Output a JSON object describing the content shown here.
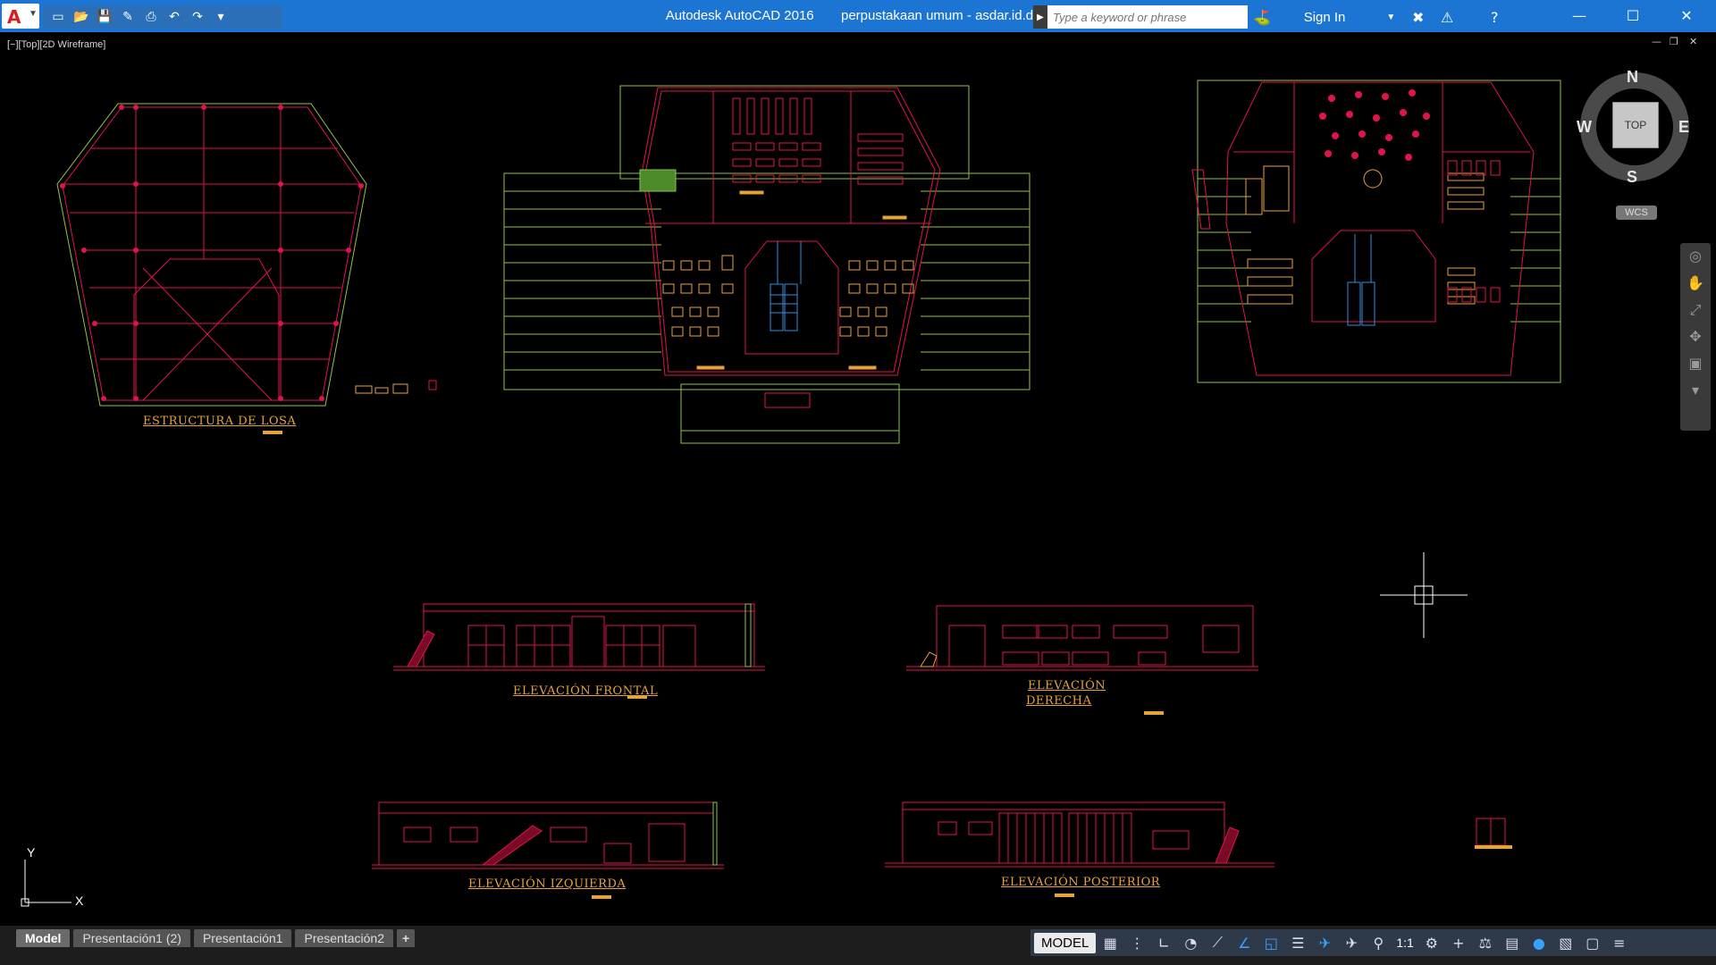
{
  "titlebar": {
    "app_name": "Autodesk AutoCAD 2016",
    "file_name": "perpustakaan umum - asdar.id.dwg",
    "search_placeholder": "Type a keyword or phrase",
    "sign_in": "Sign In",
    "bg_color": "#1c75d3"
  },
  "quick_access": [
    "new-icon",
    "open-icon",
    "save-icon",
    "save-as-icon",
    "plot-icon",
    "undo-icon",
    "redo-icon",
    "customize-icon"
  ],
  "window_controls": [
    "minimize-icon",
    "maximize-icon",
    "close-icon"
  ],
  "viewport": {
    "label": "[−][Top][2D Wireframe]",
    "bg_color": "#000000"
  },
  "drawing_labels": {
    "estructura": "ESTRUCTURA DE LOSA",
    "frontal": "ELEVACIÓN FRONTAL",
    "derecha_1": "ELEVACIÓN",
    "derecha_2": "DERECHA",
    "izquierda": "ELEVACIÓN IZQUIERDA",
    "posterior": "ELEVACIÓN POSTERIOR"
  },
  "viewcube": {
    "north": "N",
    "south": "S",
    "east": "E",
    "west": "W",
    "face": "TOP",
    "wcs": "WCS"
  },
  "ucs": {
    "x": "X",
    "y": "Y"
  },
  "layout_tabs": [
    {
      "label": "Model",
      "active": true
    },
    {
      "label": "Presentación1 (2)",
      "active": false
    },
    {
      "label": "Presentación1",
      "active": false
    },
    {
      "label": "Presentación2",
      "active": false
    },
    {
      "label": "+",
      "active": false
    }
  ],
  "statusbar": {
    "model": "MODEL",
    "scale": "1:1"
  },
  "colors": {
    "line_red": "#e0144c",
    "line_green": "#8fc63f",
    "line_orange": "#e8a23a",
    "line_blue": "#2f8fe0"
  }
}
